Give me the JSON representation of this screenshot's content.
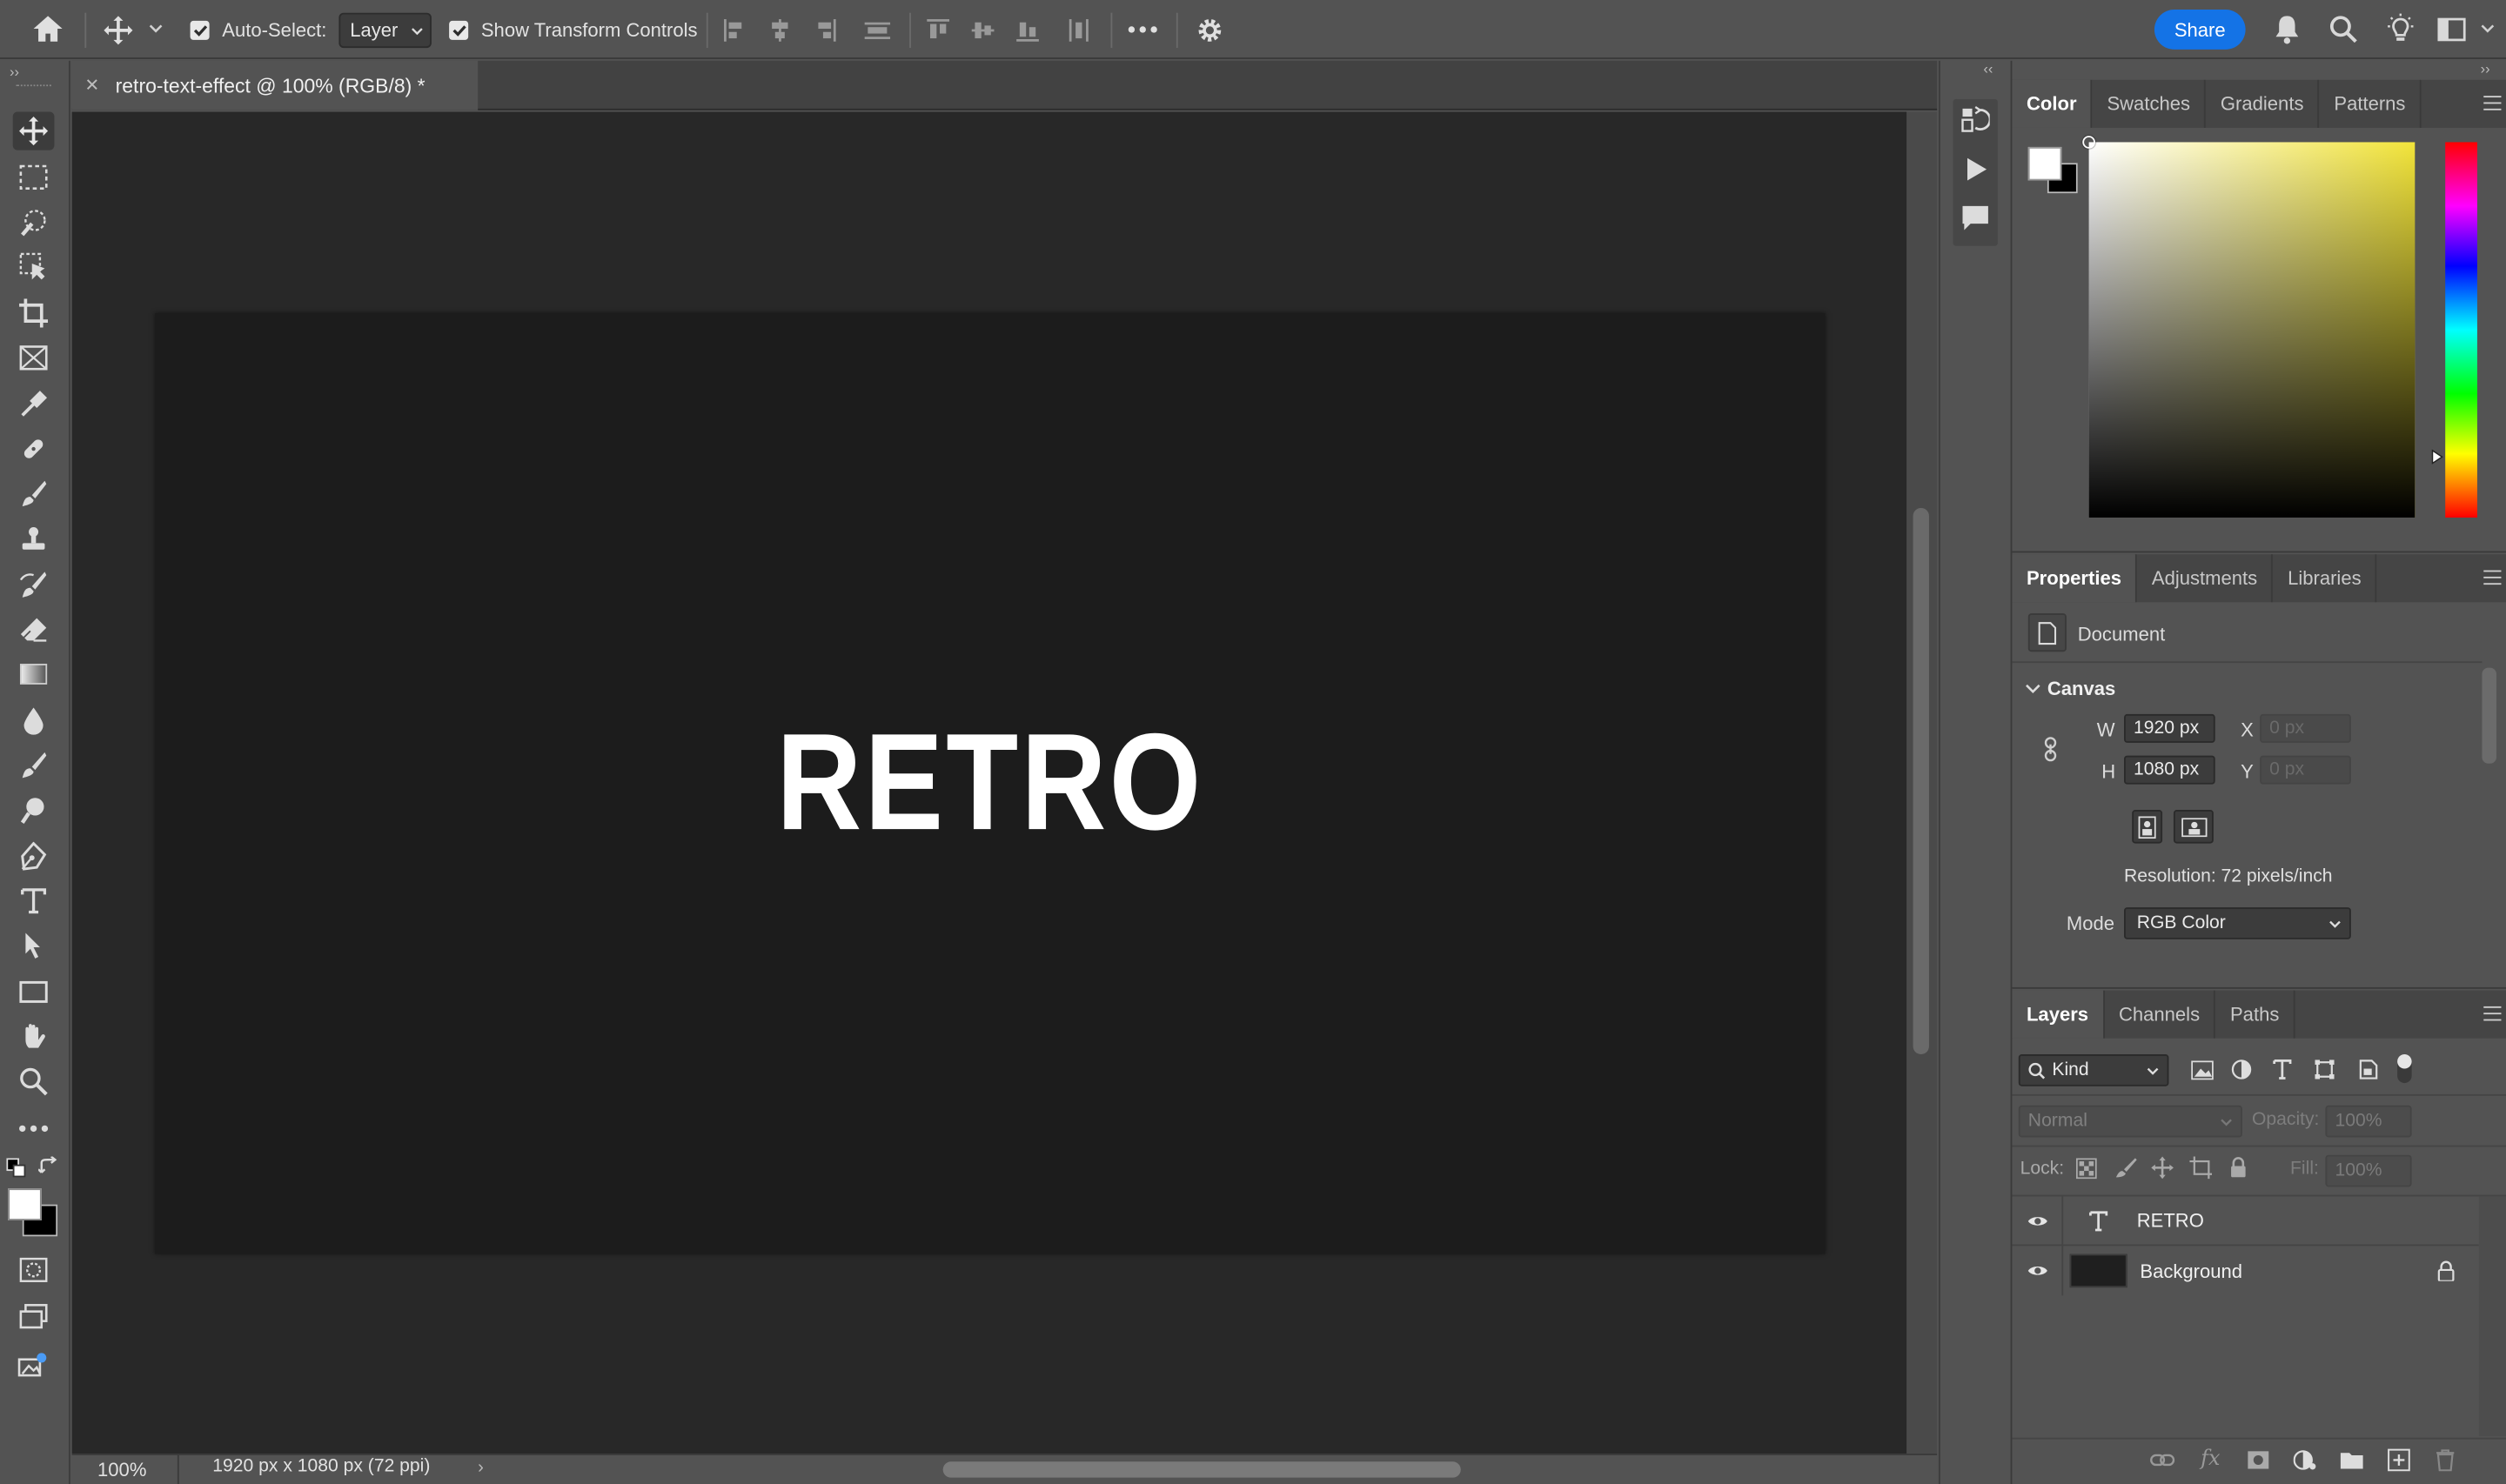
{
  "options_bar": {
    "auto_select_label": "Auto-Select:",
    "auto_select_value": "Layer",
    "transform_controls_label": "Show Transform Controls",
    "share_label": "Share"
  },
  "document": {
    "tab_title": "retro-text-effect @ 100% (RGB/8) *",
    "canvas_text": "RETRO"
  },
  "status": {
    "zoom": "100%",
    "doc_info": "1920 px x 1080 px (72 ppi)"
  },
  "color_panel": {
    "tabs": [
      "Color",
      "Swatches",
      "Gradients",
      "Patterns"
    ],
    "hue_color": "#f2e43a"
  },
  "properties_panel": {
    "tabs": [
      "Properties",
      "Adjustments",
      "Libraries"
    ],
    "type_label": "Document",
    "section_title": "Canvas",
    "w_label": "W",
    "w_value": "1920 px",
    "h_label": "H",
    "h_value": "1080 px",
    "x_label": "X",
    "x_placeholder": "0 px",
    "y_label": "Y",
    "y_placeholder": "0 px",
    "resolution": "Resolution: 72 pixels/inch",
    "mode_label": "Mode",
    "mode_value": "RGB Color"
  },
  "layers_panel": {
    "tabs": [
      "Layers",
      "Channels",
      "Paths"
    ],
    "filter_kind": "Kind",
    "blend_mode": "Normal",
    "opacity_label": "Opacity:",
    "opacity_value": "100%",
    "lock_label": "Lock:",
    "fill_label": "Fill:",
    "fill_value": "100%",
    "layers": [
      {
        "name": "RETRO",
        "type": "text"
      },
      {
        "name": "Background",
        "type": "pixel",
        "locked": true
      }
    ]
  },
  "colors": {
    "accent": "#1473e6",
    "foreground_swatch": "#ffffff",
    "background_swatch": "#000000"
  }
}
